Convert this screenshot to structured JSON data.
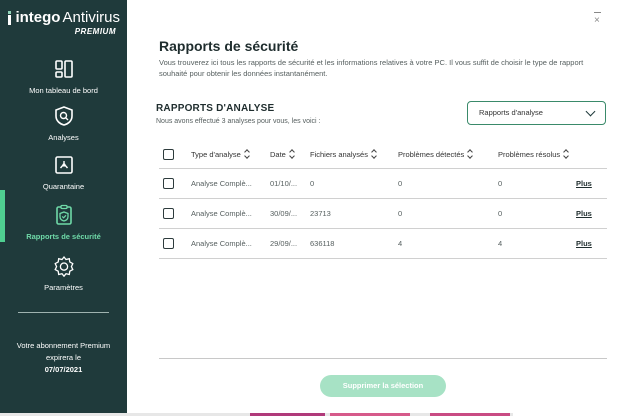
{
  "app": {
    "brand": "intego",
    "product": "Antivirus",
    "tier": "PREMIUM"
  },
  "window": {
    "minimize_icon": "minimize-icon",
    "close_icon": "close-icon",
    "close_glyph": "×"
  },
  "sidebar": {
    "items": [
      {
        "label": "Mon tableau de bord",
        "icon": "dashboard-icon",
        "active": false
      },
      {
        "label": "Analyses",
        "icon": "scan-icon",
        "active": false
      },
      {
        "label": "Quarantaine",
        "icon": "quarantine-icon",
        "active": false
      },
      {
        "label": "Rapports de sécurité",
        "icon": "report-icon",
        "active": true
      },
      {
        "label": "Paramètres",
        "icon": "settings-icon",
        "active": false
      }
    ],
    "subscription": {
      "line1": "Votre abonnement Premium",
      "line2": "expirera le",
      "date": "07/07/2021"
    }
  },
  "main": {
    "title": "Rapports de sécurité",
    "description": "Vous trouverez ici tous les rapports de sécurité et les informations relatives à votre PC. Il vous suffit de choisir le type de rapport souhaité pour obtenir les données instantanément.",
    "section_title": "RAPPORTS D'ANALYSE",
    "section_subtitle": "Nous avons effectué 3 analyses pour vous, les voici :",
    "report_type_select": "Rapports d'analyse",
    "table": {
      "headers": [
        "Type d'analyse",
        "Date",
        "Fichiers analysés",
        "Problèmes détectés",
        "Problèmes résolus"
      ],
      "rows": [
        {
          "type": "Analyse Complè...",
          "date": "01/10/...",
          "files": "0",
          "detected": "0",
          "resolved": "0",
          "action": "Plus"
        },
        {
          "type": "Analyse Complè...",
          "date": "30/09/...",
          "files": "23713",
          "detected": "0",
          "resolved": "0",
          "action": "Plus"
        },
        {
          "type": "Analyse Complè...",
          "date": "29/09/...",
          "files": "636118",
          "detected": "4",
          "resolved": "4",
          "action": "Plus"
        }
      ]
    },
    "delete_button": "Supprimer la sélection"
  },
  "colors": {
    "sidebar_bg": "#1f3a3b",
    "accent": "#4fcf91",
    "button_disabled": "#a7e2c5"
  }
}
